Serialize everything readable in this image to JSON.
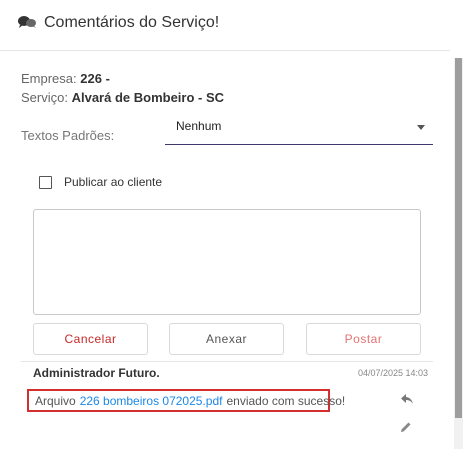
{
  "header": {
    "title": "Comentários do Serviço!",
    "icon": "chat-bubbles-icon"
  },
  "info": {
    "empresa_label": "Empresa:",
    "empresa_value": "226 -",
    "servico_label": "Serviço:",
    "servico_value": "Alvará de Bombeiro - SC"
  },
  "textos_padroes": {
    "label": "Textos Padrões:",
    "selected": "Nenhum"
  },
  "publicar": {
    "label": "Publicar ao cliente",
    "checked": false
  },
  "comment": {
    "value": "",
    "placeholder": ""
  },
  "buttons": {
    "cancelar": "Cancelar",
    "anexar": "Anexar",
    "postar": "Postar"
  },
  "comments": [
    {
      "author": "Administrador Futuro.",
      "timestamp": "04/07/2025 14:03",
      "text_before": "Arquivo",
      "link": "226 bombeiros 072025.pdf",
      "text_after": "enviado com sucesso!"
    }
  ],
  "colors": {
    "cancel": "#c62828",
    "post": "#e57373",
    "link": "#1e88e5",
    "highlight_border": "#d32f2f",
    "select_underline": "#3f3a6b"
  }
}
